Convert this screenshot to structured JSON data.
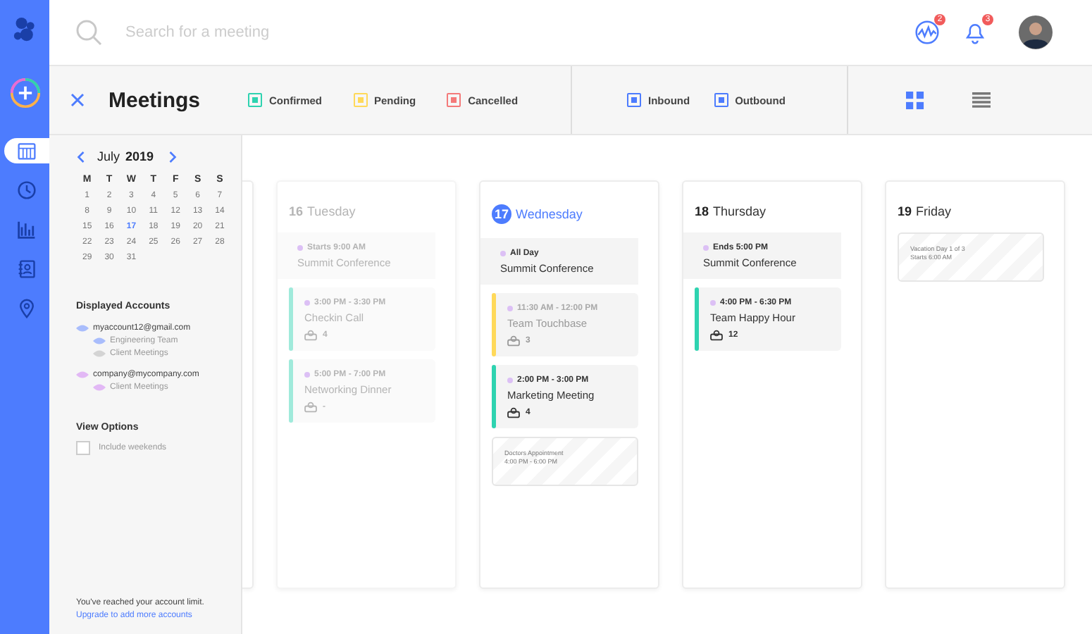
{
  "search": {
    "placeholder": "Search for a meeting"
  },
  "badges": [
    {
      "count": "2"
    },
    {
      "count": "3"
    }
  ],
  "page_title": "Meetings",
  "status_legend": [
    {
      "label": "Confirmed",
      "color": "#2ed3b0"
    },
    {
      "label": "Pending",
      "color": "#ffd95a"
    },
    {
      "label": "Cancelled",
      "color": "#f47a7a"
    }
  ],
  "direction_legend": [
    {
      "label": "Inbound",
      "color": "#4d7cfe"
    },
    {
      "label": "Outbound",
      "color": "#4d7cfe"
    }
  ],
  "view_toggle": [
    {
      "selected": true
    },
    {
      "selected": false
    }
  ],
  "nav": [
    {
      "selected": true
    },
    {
      "selected": false
    },
    {
      "selected": false
    },
    {
      "selected": false
    },
    {
      "selected": false
    }
  ],
  "calendar": {
    "month": "July",
    "year": "2019",
    "weekdays": [
      "M",
      "T",
      "W",
      "T",
      "F",
      "S",
      "S"
    ],
    "days": [
      {
        "label": "1",
        "selected": false
      },
      {
        "label": "2",
        "selected": false
      },
      {
        "label": "3",
        "selected": false
      },
      {
        "label": "4",
        "selected": false
      },
      {
        "label": "5",
        "selected": false
      },
      {
        "label": "6",
        "selected": false
      },
      {
        "label": "7",
        "selected": false
      },
      {
        "label": "8",
        "selected": false
      },
      {
        "label": "9",
        "selected": false
      },
      {
        "label": "10",
        "selected": false
      },
      {
        "label": "11",
        "selected": false
      },
      {
        "label": "12",
        "selected": false
      },
      {
        "label": "13",
        "selected": false
      },
      {
        "label": "14",
        "selected": false
      },
      {
        "label": "15",
        "selected": false
      },
      {
        "label": "16",
        "selected": false
      },
      {
        "label": "17",
        "selected": true
      },
      {
        "label": "18",
        "selected": false
      },
      {
        "label": "19",
        "selected": false
      },
      {
        "label": "20",
        "selected": false
      },
      {
        "label": "21",
        "selected": false
      },
      {
        "label": "22",
        "selected": false
      },
      {
        "label": "23",
        "selected": false
      },
      {
        "label": "24",
        "selected": false
      },
      {
        "label": "25",
        "selected": false
      },
      {
        "label": "26",
        "selected": false
      },
      {
        "label": "27",
        "selected": false
      },
      {
        "label": "28",
        "selected": false
      },
      {
        "label": "29",
        "selected": false
      },
      {
        "label": "30",
        "selected": false
      },
      {
        "label": "31",
        "selected": false
      }
    ]
  },
  "accounts_heading": "Displayed Accounts",
  "accounts": [
    {
      "label": "myaccount12@gmail.com",
      "color": "#a9bdfc",
      "children": [
        {
          "label": "Engineering Team",
          "color": "#a9bdfc"
        },
        {
          "label": "Client Meetings",
          "color": "#d4d4d4"
        }
      ]
    },
    {
      "label": "company@mycompany.com",
      "color": "#e2b8f5",
      "children": [
        {
          "label": "Client Meetings",
          "color": "#e2b8f5"
        }
      ]
    }
  ],
  "view_options": {
    "heading": "View Options",
    "include_weekends": {
      "label": "Include weekends",
      "checked": false
    }
  },
  "limit_note": "You've reached your account limit.",
  "upgrade_link": "Upgrade to add more accounts",
  "days": [
    {
      "number": "16",
      "name": "Tuesday",
      "past": true,
      "selected": false,
      "events": [
        {
          "kind": "span",
          "time": "Starts 9:00 AM",
          "title": "Summit Conference"
        },
        {
          "kind": "meeting",
          "time": "3:00 PM - 3:30 PM",
          "title": "Checkin Call",
          "attendees": "4",
          "color": "#a0eadb"
        },
        {
          "kind": "meeting",
          "time": "5:00 PM - 7:00 PM",
          "title": "Networking Dinner",
          "attendees": "-",
          "color": "#a0eadb"
        }
      ]
    },
    {
      "number": "17",
      "name": "Wednesday",
      "past": false,
      "selected": true,
      "events": [
        {
          "kind": "span",
          "time": "All Day",
          "title": "Summit Conference"
        },
        {
          "kind": "meeting",
          "time": "11:30 AM - 12:00 PM",
          "title": "Team Touchbase",
          "attendees": "3",
          "color": "#ffd95a",
          "faded": true
        },
        {
          "kind": "meeting",
          "time": "2:00 PM - 3:00 PM",
          "title": "Marketing Meeting",
          "attendees": "4",
          "color": "#2ed3b0",
          "faded": false
        },
        {
          "kind": "blocked",
          "title": "Doctors Appointment",
          "time": "4:00 PM - 6:00 PM"
        }
      ]
    },
    {
      "number": "18",
      "name": "Thursday",
      "past": false,
      "selected": false,
      "events": [
        {
          "kind": "span",
          "time": "Ends 5:00 PM",
          "title": "Summit Conference"
        },
        {
          "kind": "meeting",
          "time": "4:00 PM - 6:30 PM",
          "title": "Team Happy Hour",
          "attendees": "12",
          "color": "#2ed3b0",
          "faded": false
        }
      ]
    },
    {
      "number": "19",
      "name": "Friday",
      "past": false,
      "selected": false,
      "events": [
        {
          "kind": "blocked",
          "title": "Vacation Day 1 of 3",
          "time": "Starts 6:00 AM"
        }
      ]
    }
  ]
}
